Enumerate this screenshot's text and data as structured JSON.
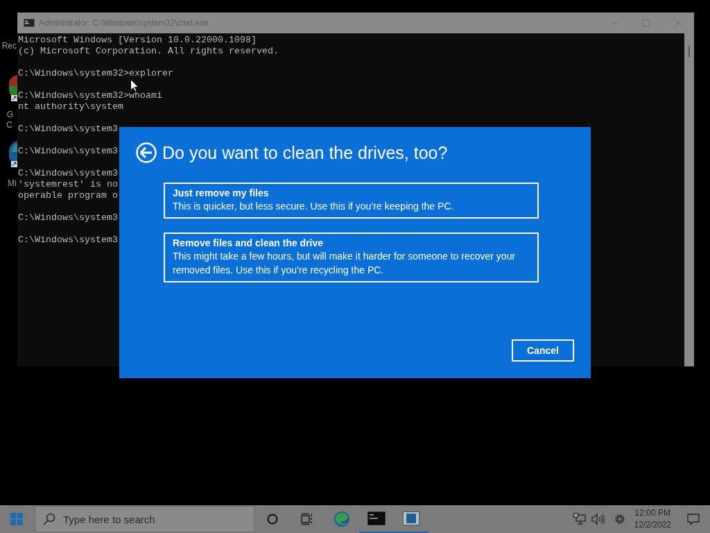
{
  "desktop_icons": [
    {
      "lines": [
        "Rec"
      ]
    },
    {
      "kind": "chrome",
      "lines": [
        "G",
        "C"
      ]
    },
    {
      "kind": "edge",
      "lines": [
        "Mi"
      ]
    }
  ],
  "cmd_window": {
    "title": "Administrator: C:\\Windows\\system32\\cmd.exe",
    "blocks": [
      [
        "Microsoft Windows [Version 10.0.22000.1098]",
        "(c) Microsoft Corporation. All rights reserved."
      ],
      [
        "C:\\Windows\\system32>explorer"
      ],
      [
        "C:\\Windows\\system32>whoami",
        "nt authority\\system"
      ],
      [
        "C:\\Windows\\system3"
      ],
      [
        "C:\\Windows\\system3"
      ],
      [
        "C:\\Windows\\system3",
        "'systemrest' is no",
        "operable program o"
      ],
      [
        "C:\\Windows\\system3"
      ],
      [
        "C:\\Windows\\system3"
      ]
    ]
  },
  "dialog": {
    "title": "Do you want to clean the drives, too?",
    "options": [
      {
        "title": "Just remove my files",
        "description": "This is quicker, but less secure. Use this if you’re keeping the PC."
      },
      {
        "title": "Remove files and clean the drive",
        "description": "This might take a few hours, but will make it harder for someone to recover your removed files. Use this if you’re recycling the PC."
      }
    ],
    "cancel": "Cancel"
  },
  "taskbar": {
    "search": {
      "placeholder": "Type here to search"
    },
    "apps": [
      {
        "kind": "edge",
        "running": false
      },
      {
        "kind": "cmd",
        "running": true
      },
      {
        "kind": "window",
        "running": true
      }
    ],
    "clock": {
      "time": "12:00 PM",
      "date": "12/2/2022"
    }
  }
}
